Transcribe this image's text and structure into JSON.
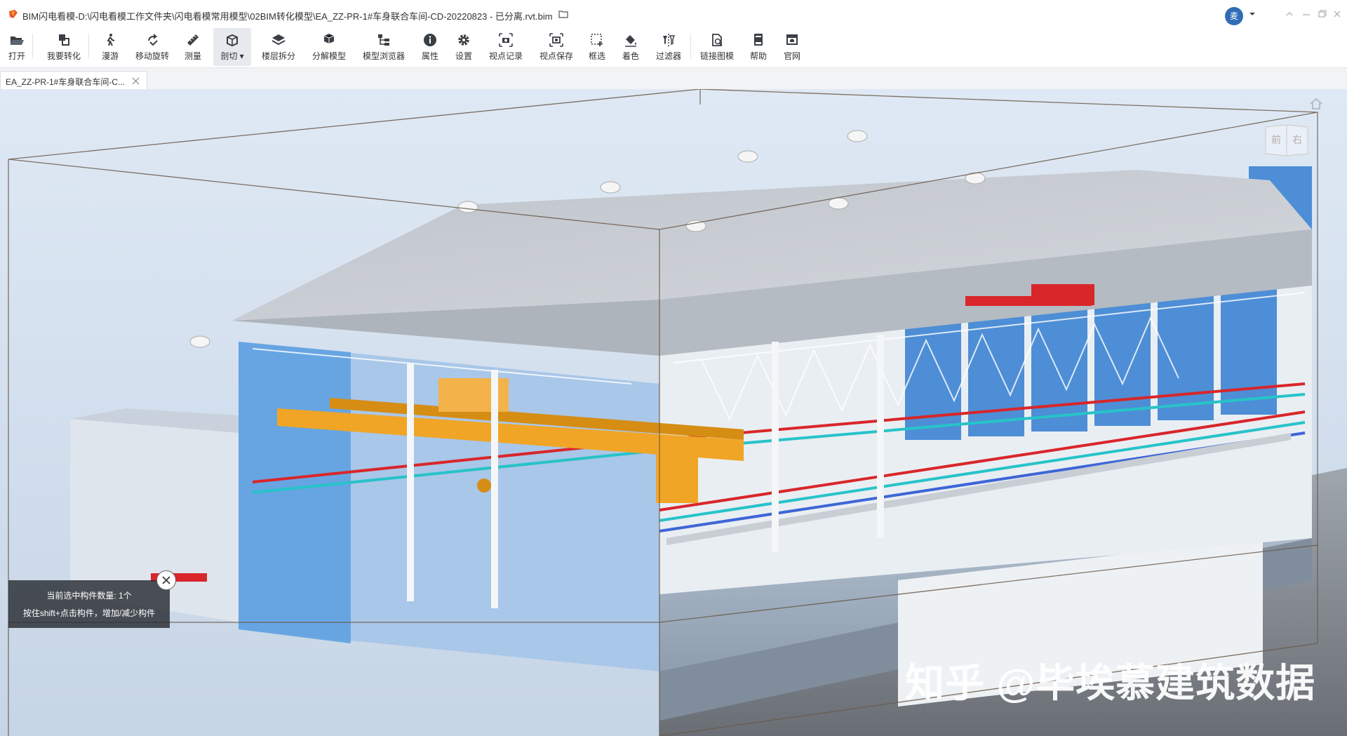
{
  "window": {
    "title": "BIM闪电看模-D:\\闪电看模工作文件夹\\闪电看模常用模型\\02BIM转化模型\\EA_ZZ-PR-1#车身联合车间-CD-20220823 - 已分离.rvt.bim",
    "user_avatar_text": "麦"
  },
  "toolbar": {
    "items": [
      {
        "label": "打开",
        "icon": "folder-open-icon"
      },
      {
        "label": "我要转化",
        "icon": "convert-icon"
      },
      {
        "label": "漫游",
        "icon": "walk-icon"
      },
      {
        "label": "移动旋转",
        "icon": "rotate-icon"
      },
      {
        "label": "测量",
        "icon": "ruler-icon"
      },
      {
        "label": "剖切",
        "icon": "section-box-icon"
      },
      {
        "label": "楼层拆分",
        "icon": "layers-icon"
      },
      {
        "label": "分解模型",
        "icon": "explode-icon"
      },
      {
        "label": "模型浏览器",
        "icon": "tree-icon"
      },
      {
        "label": "属性",
        "icon": "info-icon"
      },
      {
        "label": "设置",
        "icon": "gear-icon"
      },
      {
        "label": "视点记录",
        "icon": "camera-record-icon"
      },
      {
        "label": "视点保存",
        "icon": "camera-save-icon"
      },
      {
        "label": "框选",
        "icon": "box-select-icon"
      },
      {
        "label": "着色",
        "icon": "paint-bucket-icon"
      },
      {
        "label": "过滤器",
        "icon": "filter-icon"
      },
      {
        "label": "链接图模",
        "icon": "link-icon"
      },
      {
        "label": "帮助",
        "icon": "help-book-icon"
      },
      {
        "label": "官网",
        "icon": "website-icon"
      }
    ],
    "active_item": "剖切"
  },
  "tabs": [
    {
      "label": "EA_ZZ-PR-1#车身联合车间-C..."
    }
  ],
  "viewcube": {
    "left_face": "前",
    "right_face": "右"
  },
  "status": {
    "selected_count": "当前选中构件数量: 1个",
    "hint": "按住shift+点击构件，增加/减少构件"
  },
  "watermark": "知乎 @毕埃慕建筑数据",
  "colors": {
    "accent": "#2f6db5",
    "crane": "#f0a526",
    "pipe_red": "#d9262a",
    "pipe_cyan": "#27c3c9",
    "wall_blue": "#5a9fe0"
  }
}
